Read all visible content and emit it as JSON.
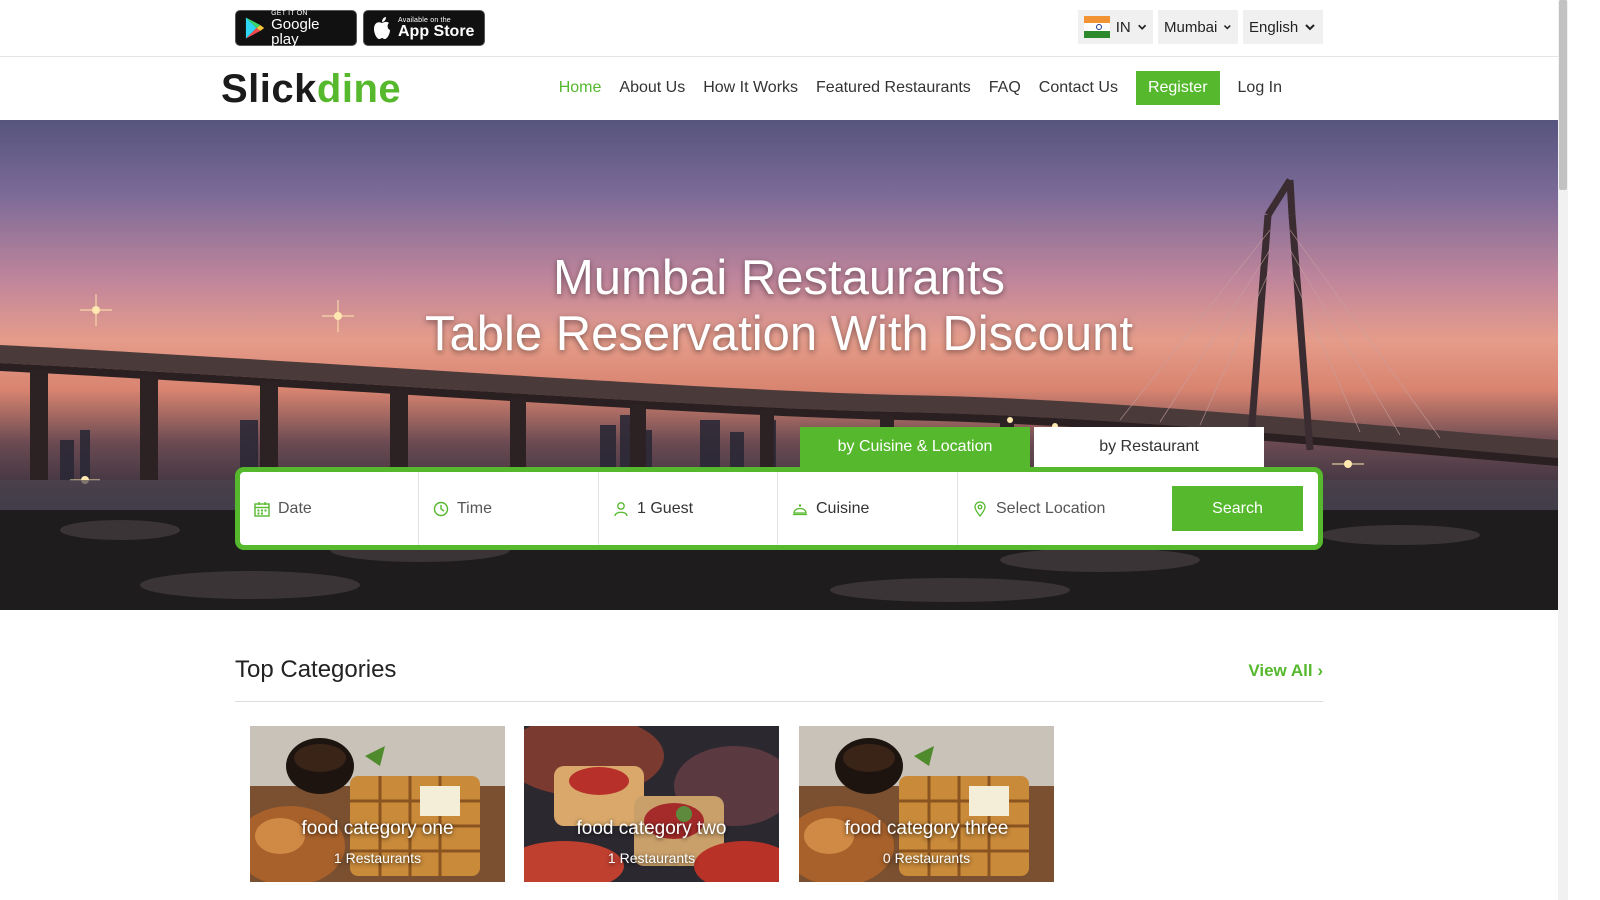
{
  "app_badges": {
    "google_play": {
      "small": "GET IT ON",
      "big": "Google play"
    },
    "app_store": {
      "small": "Available on the",
      "big": "App Store"
    }
  },
  "selectors": {
    "country": "IN",
    "city": "Mumbai",
    "language": "English"
  },
  "logo": {
    "part1": "Slick",
    "part2": "dine"
  },
  "nav": {
    "home": "Home",
    "about": "About Us",
    "how": "How It Works",
    "featured": "Featured Restaurants",
    "faq": "FAQ",
    "contact": "Contact Us",
    "register": "Register",
    "login": "Log In"
  },
  "hero": {
    "line1": "Mumbai Restaurants",
    "line2": "Table Reservation With Discount"
  },
  "search_tabs": {
    "cuisine_location": "by Cuisine & Location",
    "restaurant": "by Restaurant"
  },
  "search": {
    "date_placeholder": "Date",
    "time_placeholder": "Time",
    "guests": "1 Guest",
    "cuisine": "Cuisine",
    "location_placeholder": "Select Location",
    "button": "Search"
  },
  "categories": {
    "title": "Top Categories",
    "view_all": "View All",
    "items": [
      {
        "name": "food category one",
        "count": "1 Restaurants"
      },
      {
        "name": "food category two",
        "count": "1 Restaurants"
      },
      {
        "name": "food category three",
        "count": "0 Restaurants"
      }
    ]
  },
  "colors": {
    "accent": "#55b82d",
    "text": "#222222"
  }
}
